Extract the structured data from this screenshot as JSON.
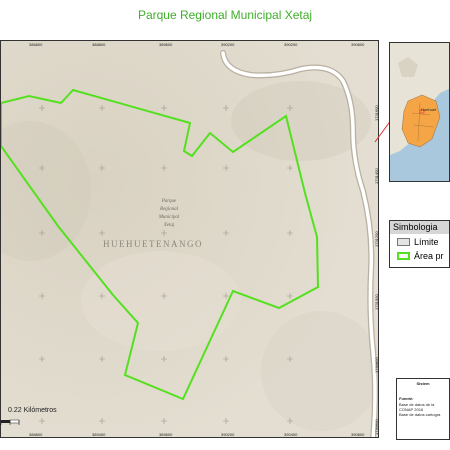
{
  "map_title": "Parque Regional Municipal Xetaj",
  "park_label": [
    "Parque",
    "Regional",
    "Municipal",
    "Xetaj"
  ],
  "region_label": "HUEHUETENANGO",
  "top_coords": [
    "386800",
    "388800",
    "389600",
    "390200",
    "390200",
    "390800"
  ],
  "bottom_coords": [
    "388800",
    "389400",
    "389600",
    "390200",
    "390400",
    "390800"
  ],
  "right_coords": [
    "1731600",
    "1731400",
    "1731200",
    "1731000",
    "1730800",
    "1730600"
  ],
  "scale_label": "0.22 Kilómetros",
  "legend": {
    "title": "Simbologia",
    "items": [
      "Límite",
      "Área pr"
    ]
  },
  "info": {
    "system": "Sistem",
    "source_title": "Fuente:",
    "lines": [
      "Base de datos de la",
      "CONAP 2016",
      "Base de datos cartogra"
    ]
  },
  "inset_labels": [
    "Huehuet"
  ],
  "colors": {
    "title": "#3fae2a",
    "boundary": "#55e01f",
    "terrain": "#ddd7c8",
    "inset_region": "#f5a546",
    "inset_sea": "#a9c8dd",
    "pointer": "#e03131"
  }
}
